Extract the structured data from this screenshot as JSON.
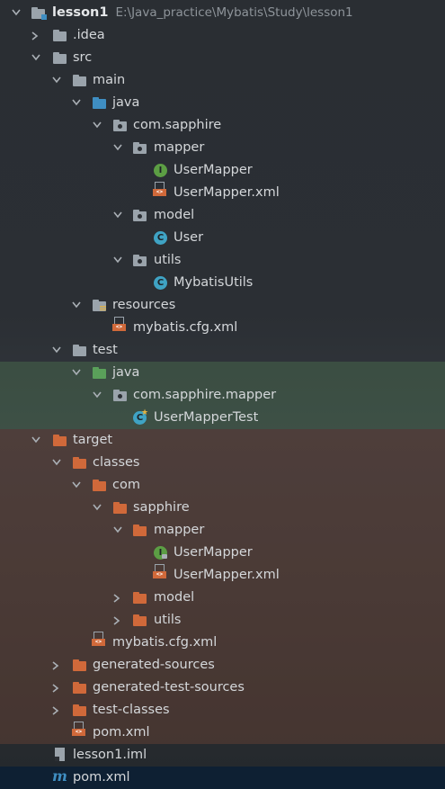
{
  "colors": {
    "folder_grey": "#9aa3ab",
    "folder_blue": "#3f8ec2",
    "folder_green": "#5aa05a",
    "folder_orange": "#d0693a",
    "class_icon": "#3fa3c4",
    "interface_icon": "#5c9e44",
    "selection": "#0e2033"
  },
  "tree": {
    "root_label": "lesson1",
    "root_path": "E:\\Java_practice\\Mybatis\\Study\\lesson1",
    "idea": ".idea",
    "src": "src",
    "main": "main",
    "java_main": "java",
    "pkg_main": "com.sapphire",
    "mapper_pkg": "mapper",
    "user_mapper": "UserMapper",
    "user_mapper_xml": "UserMapper.xml",
    "model_pkg": "model",
    "user_class": "User",
    "utils_pkg": "utils",
    "mybatis_utils": "MybatisUtils",
    "resources": "resources",
    "mybatis_cfg": "mybatis.cfg.xml",
    "test": "test",
    "java_test": "java",
    "pkg_test": "com.sapphire.mapper",
    "user_mapper_test": "UserMapperTest",
    "target": "target",
    "classes": "classes",
    "com": "com",
    "sapphire": "sapphire",
    "t_mapper": "mapper",
    "t_user_mapper": "UserMapper",
    "t_user_mapper_xml": "UserMapper.xml",
    "t_model": "model",
    "t_utils": "utils",
    "t_mybatis_cfg": "mybatis.cfg.xml",
    "generated_sources": "generated-sources",
    "generated_test_sources": "generated-test-sources",
    "test_classes": "test-classes",
    "t_pom": "pom.xml",
    "lesson_iml": "lesson1.iml",
    "pom": "pom.xml"
  }
}
